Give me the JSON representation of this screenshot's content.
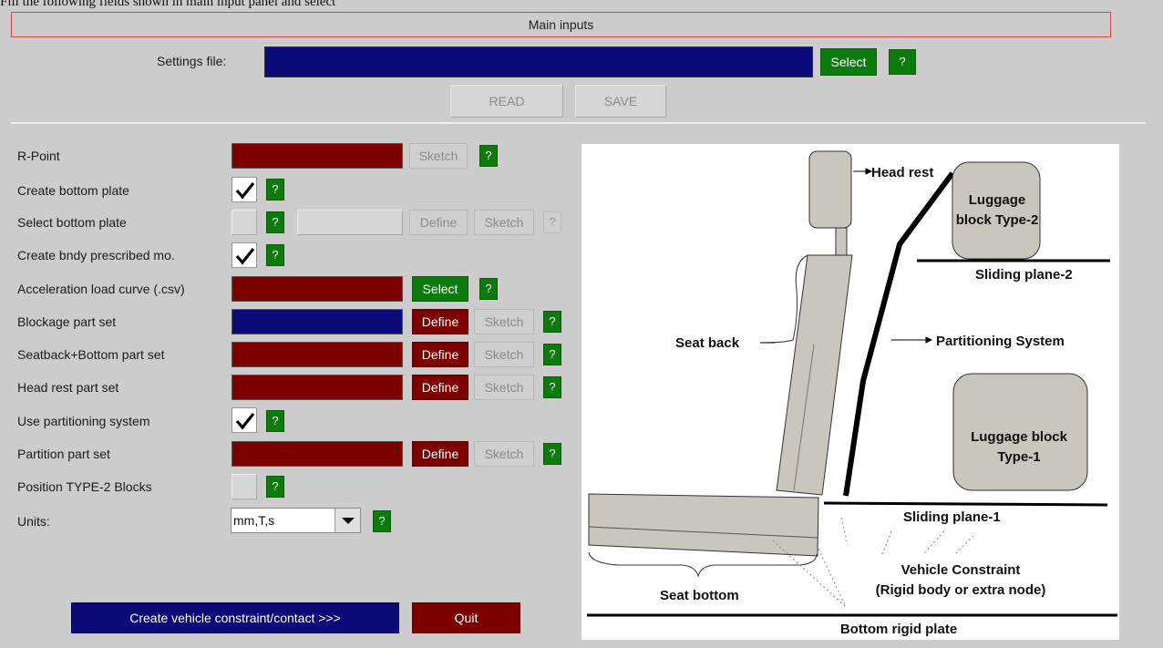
{
  "top_caption": "Fill the following fields shown in main input panel and select",
  "panel": {
    "title": "Main inputs",
    "settings_file_label": "Settings file:",
    "select_label": "Select",
    "help_label": "?",
    "read_label": "READ",
    "save_label": "SAVE"
  },
  "rows": {
    "r_point": "R-Point",
    "create_bottom_plate": "Create bottom plate",
    "select_bottom_plate": "Select bottom plate",
    "create_bndy": "Create bndy prescribed mo.",
    "accel_curve": "Acceleration load curve (.csv)",
    "blockage": "Blockage part set",
    "seatback_bottom": "Seatback+Bottom part set",
    "head_rest": "Head rest part set",
    "use_partitioning": "Use partitioning system",
    "partition_part_set": "Partition part set",
    "position_type2": "Position TYPE-2 Blocks",
    "units": "Units:"
  },
  "buttons": {
    "sketch": "Sketch",
    "define": "Define",
    "select": "Select",
    "help": "?",
    "create_vehicle": "Create vehicle constraint/contact >>>",
    "quit": "Quit"
  },
  "units_value": "mm,T,s",
  "diagram": {
    "head_rest": "Head rest",
    "luggage_type2_line1": "Luggage",
    "luggage_type2_line2": "block Type-2",
    "sliding_plane_2": "Sliding plane-2",
    "seat_back": "Seat back",
    "partitioning_system": "Partitioning System",
    "luggage_type1_line1": "Luggage block",
    "luggage_type1_line2": "Type-1",
    "sliding_plane_1": "Sliding plane-1",
    "vehicle_constraint": "Vehicle Constraint",
    "rigid_body": "(Rigid body or extra node)",
    "seat_bottom": "Seat bottom",
    "bottom_rigid_plate": "Bottom rigid plate"
  },
  "colors": {
    "panel_bg": "#cccccc",
    "navy_field": "#0a0a78",
    "maroon_field": "#7d0000",
    "help_green": "#0d7a0d",
    "main_border": "#d34848"
  }
}
